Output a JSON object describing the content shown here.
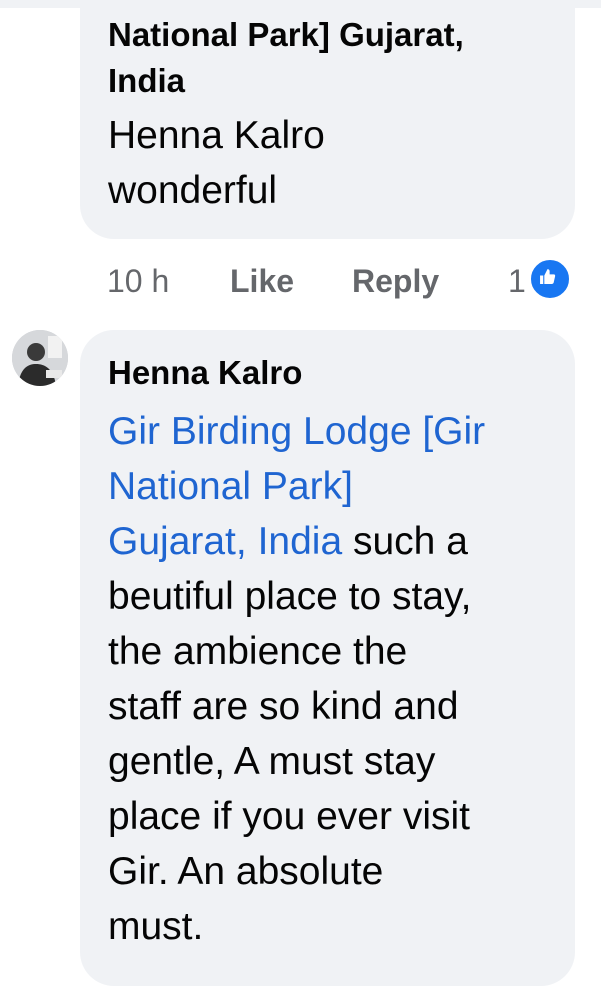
{
  "previous_comment": {
    "place_line_1": "National Park] Gujarat,",
    "place_line_2": "India",
    "mention": "Henna Kalro",
    "text": "wonderful",
    "time": "10 h",
    "like_label": "Like",
    "reply_label": "Reply",
    "reaction_count": "1"
  },
  "comment": {
    "author": "Henna Kalro",
    "mention_line_1": "Gir Birding Lodge [Gir",
    "mention_line_2": "National Park]",
    "mention_line_3": "Gujarat, India",
    "text_line_1": " such a",
    "text_line_2": "beutiful place to stay,",
    "text_line_3": "the ambience the",
    "text_line_4": "staff are so kind and",
    "text_line_5": "gentle, A must stay",
    "text_line_6": "place if you ever visit",
    "text_line_7": "Gir. An absolute",
    "text_line_8": "must."
  },
  "colors": {
    "bubble": "#f0f2f5",
    "mention": "#1f65d1",
    "meta": "#65676b",
    "like_badge": "#1877f2"
  }
}
